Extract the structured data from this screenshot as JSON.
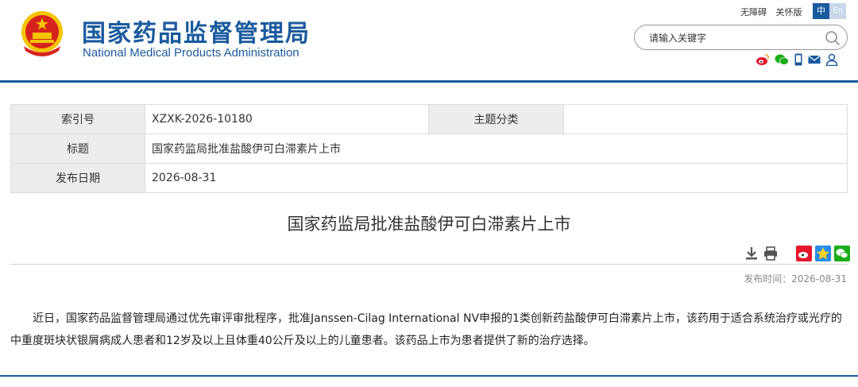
{
  "header": {
    "site_name_cn": "国家药品监督管理局",
    "site_name_en": "National Medical Products Administration",
    "top_links": [
      "无障碍",
      "关怀版"
    ],
    "lang_cn": "中",
    "lang_en": "En",
    "search_placeholder": "请输入关键字",
    "social_icons": [
      "weibo-icon",
      "wechat-icon",
      "mobile-icon",
      "mail-icon",
      "user-icon"
    ]
  },
  "info_table": {
    "index_label": "索引号",
    "index_value": "XZXK-2026-10180",
    "topic_label": "主题分类",
    "topic_value": "",
    "title_label": "标题",
    "title_value": "国家药监局批准盐酸伊可白滞素片上市",
    "date_label": "发布日期",
    "date_value": "2026-08-31"
  },
  "article": {
    "title": "国家药监局批准盐酸伊可白滞素片上市",
    "publish_time": "发布时间：2026-08-31",
    "body": "近日，国家药品监督管理局通过优先审评审批程序，批准Janssen-Cilag International NV申报的1类创新药盐酸伊可白滞素片上市，该药用于适合系统治疗或光疗的中重度斑块状银屑病成人患者和12岁及以上且体重40公斤及以上的儿童患者。该药品上市为患者提供了新的治疗选择。",
    "tool_icons": [
      "download-icon",
      "print-icon",
      "share-weibo-icon",
      "share-qzone-icon",
      "share-wechat-icon"
    ]
  },
  "colors": {
    "brand_blue": "#1a5a9e",
    "emblem_red": "#d7231e",
    "emblem_gold": "#f4c400"
  }
}
